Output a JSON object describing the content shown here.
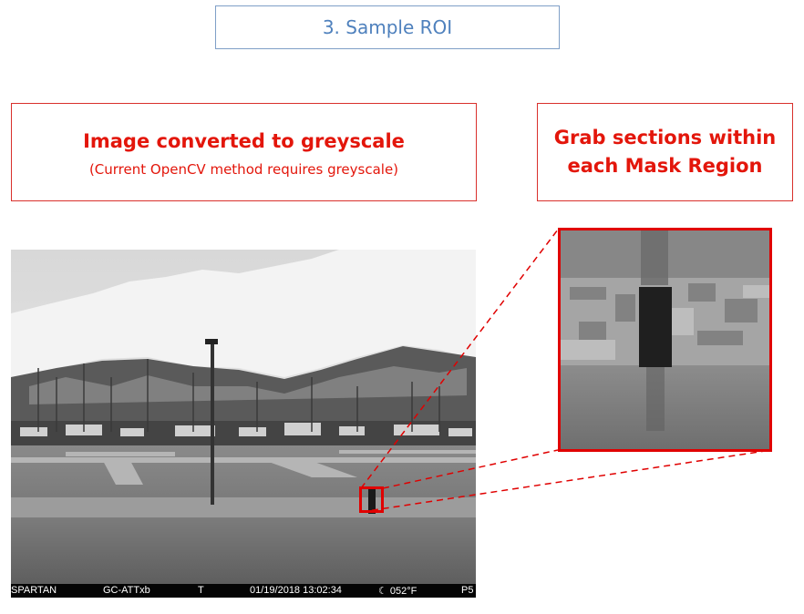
{
  "slide": {
    "title": "3. Sample ROI"
  },
  "left_callout": {
    "heading": "Image converted to greyscale",
    "subtext": "(Current OpenCV method requires greyscale)"
  },
  "right_callout": {
    "heading_line1": "Grab sections within",
    "heading_line2": "each Mask Region"
  },
  "camera_overlay": {
    "camera_name": "SPARTAN",
    "camera_id": "GC-ATTxb",
    "flag": "T",
    "timestamp": "01/19/2018 13:02:34",
    "temperature": "☾ 052°F",
    "suffix": "P5"
  },
  "colors": {
    "accent_red": "#e3160b",
    "title_blue": "#4f81bd",
    "marker_red": "#e00000"
  }
}
